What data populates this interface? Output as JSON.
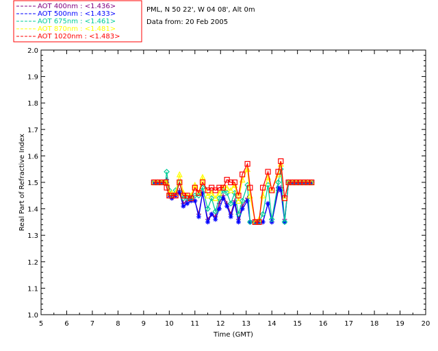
{
  "header": {
    "site_line": "PML, N 50 22', W 04 08', Alt 0m",
    "date_line": "Data from: 20 Feb 2005"
  },
  "chart_data": {
    "type": "line",
    "xlabel": "Time (GMT)",
    "ylabel": "Real Part of Refractive Index",
    "xlim": [
      5,
      20
    ],
    "ylim": [
      1.0,
      2.0
    ],
    "xticks": [
      "5",
      "6",
      "7",
      "8",
      "9",
      "10",
      "11",
      "12",
      "13",
      "14",
      "15",
      "16",
      "17",
      "18",
      "19",
      "20"
    ],
    "yticks": [
      "1.0",
      "1.1",
      "1.2",
      "1.3",
      "1.4",
      "1.5",
      "1.6",
      "1.7",
      "1.8",
      "1.9",
      "2.0"
    ],
    "grid": false,
    "legend_position": "top-left-outside",
    "series": [
      {
        "name": "AOT  400nm : <1.436>",
        "color": "#800080",
        "marker": "plus",
        "x": [
          9.4,
          9.55,
          9.7,
          9.85,
          9.9,
          10.0,
          10.1,
          10.25,
          10.4,
          10.55,
          10.7,
          10.85,
          11.0,
          11.15,
          11.3,
          11.5,
          11.65,
          11.8,
          11.95,
          12.1,
          12.25,
          12.4,
          12.55,
          12.7,
          12.85,
          13.05,
          13.15,
          13.35,
          13.5,
          13.65,
          13.85,
          14.0,
          14.25,
          14.35,
          14.5,
          14.65,
          14.8,
          14.95,
          15.1,
          15.25,
          15.4,
          15.55
        ],
        "y": [
          1.5,
          1.5,
          1.5,
          1.5,
          1.51,
          1.46,
          1.44,
          1.45,
          1.47,
          1.42,
          1.43,
          1.44,
          1.43,
          1.38,
          1.46,
          1.36,
          1.38,
          1.37,
          1.42,
          1.45,
          1.42,
          1.38,
          1.43,
          1.36,
          1.41,
          1.44,
          1.35,
          1.35,
          1.35,
          1.35,
          1.42,
          1.35,
          1.47,
          1.48,
          1.36,
          1.5,
          1.5,
          1.5,
          1.5,
          1.5,
          1.5,
          1.5
        ]
      },
      {
        "name": "AOT  500nm : <1.433>",
        "color": "#0000ff",
        "marker": "asterisk",
        "x": [
          9.4,
          9.55,
          9.7,
          9.85,
          9.9,
          10.0,
          10.1,
          10.25,
          10.4,
          10.55,
          10.7,
          10.85,
          11.0,
          11.15,
          11.3,
          11.5,
          11.65,
          11.8,
          11.95,
          12.1,
          12.25,
          12.4,
          12.55,
          12.7,
          12.85,
          13.05,
          13.15,
          13.35,
          13.5,
          13.65,
          13.85,
          14.0,
          14.25,
          14.35,
          14.5,
          14.65,
          14.8,
          14.95,
          15.1,
          15.25,
          15.4,
          15.55
        ],
        "y": [
          1.5,
          1.5,
          1.5,
          1.5,
          1.5,
          1.45,
          1.44,
          1.45,
          1.46,
          1.41,
          1.42,
          1.43,
          1.43,
          1.37,
          1.46,
          1.35,
          1.38,
          1.36,
          1.4,
          1.44,
          1.41,
          1.37,
          1.42,
          1.35,
          1.4,
          1.43,
          1.35,
          1.35,
          1.35,
          1.35,
          1.42,
          1.35,
          1.48,
          1.47,
          1.35,
          1.5,
          1.5,
          1.5,
          1.5,
          1.5,
          1.5,
          1.5
        ]
      },
      {
        "name": "AOT  675nm : <1.461>",
        "color": "#00cc99",
        "marker": "diamond",
        "x": [
          9.4,
          9.55,
          9.7,
          9.85,
          9.9,
          10.0,
          10.1,
          10.25,
          10.4,
          10.55,
          10.7,
          10.85,
          11.0,
          11.15,
          11.3,
          11.5,
          11.65,
          11.8,
          11.95,
          12.1,
          12.25,
          12.4,
          12.55,
          12.7,
          12.85,
          13.05,
          13.15,
          13.35,
          13.5,
          13.65,
          13.85,
          14.0,
          14.25,
          14.35,
          14.5,
          14.65,
          14.8,
          14.95,
          15.1,
          15.25,
          15.4,
          15.55
        ],
        "y": [
          1.5,
          1.5,
          1.5,
          1.5,
          1.54,
          1.47,
          1.45,
          1.47,
          1.5,
          1.44,
          1.44,
          1.44,
          1.45,
          1.45,
          1.48,
          1.4,
          1.44,
          1.39,
          1.44,
          1.47,
          1.46,
          1.42,
          1.46,
          1.38,
          1.43,
          1.49,
          1.35,
          1.35,
          1.35,
          1.38,
          1.49,
          1.36,
          1.5,
          1.55,
          1.35,
          1.5,
          1.5,
          1.5,
          1.5,
          1.5,
          1.5,
          1.5
        ]
      },
      {
        "name": "AOT  870nm : <1.481>",
        "color": "#ffff00",
        "marker": "triangle",
        "x": [
          9.4,
          9.55,
          9.7,
          9.85,
          9.9,
          10.0,
          10.1,
          10.25,
          10.4,
          10.55,
          10.7,
          10.85,
          11.0,
          11.15,
          11.3,
          11.5,
          11.65,
          11.8,
          11.95,
          12.1,
          12.25,
          12.4,
          12.55,
          12.7,
          12.85,
          13.05,
          13.15,
          13.35,
          13.5,
          13.65,
          13.85,
          14.0,
          14.25,
          14.35,
          14.5,
          14.65,
          14.8,
          14.95,
          15.1,
          15.25,
          15.4,
          15.55
        ],
        "y": [
          1.5,
          1.5,
          1.5,
          1.5,
          1.5,
          1.46,
          1.46,
          1.46,
          1.53,
          1.46,
          1.45,
          1.45,
          1.49,
          1.46,
          1.52,
          1.45,
          1.46,
          1.44,
          1.46,
          1.48,
          1.48,
          1.47,
          1.49,
          1.43,
          1.51,
          1.55,
          1.45,
          1.35,
          1.36,
          1.45,
          1.52,
          1.47,
          1.53,
          1.57,
          1.44,
          1.5,
          1.5,
          1.5,
          1.5,
          1.5,
          1.5,
          1.5
        ]
      },
      {
        "name": "AOT 1020nm : <1.483>",
        "color": "#ff0000",
        "marker": "square",
        "x": [
          9.4,
          9.55,
          9.7,
          9.85,
          9.9,
          10.0,
          10.1,
          10.25,
          10.4,
          10.55,
          10.7,
          10.85,
          11.0,
          11.15,
          11.3,
          11.5,
          11.65,
          11.8,
          11.95,
          12.1,
          12.25,
          12.4,
          12.55,
          12.7,
          12.85,
          13.05,
          13.15,
          13.35,
          13.5,
          13.65,
          13.85,
          14.0,
          14.25,
          14.35,
          14.5,
          14.65,
          14.8,
          14.95,
          15.1,
          15.25,
          15.4,
          15.55
        ],
        "y": [
          1.5,
          1.5,
          1.5,
          1.5,
          1.48,
          1.45,
          1.45,
          1.45,
          1.5,
          1.45,
          1.45,
          1.44,
          1.48,
          1.46,
          1.5,
          1.47,
          1.48,
          1.47,
          1.48,
          1.48,
          1.51,
          1.5,
          1.5,
          1.45,
          1.53,
          1.57,
          1.48,
          1.35,
          1.35,
          1.48,
          1.54,
          1.47,
          1.54,
          1.58,
          1.44,
          1.5,
          1.5,
          1.5,
          1.5,
          1.5,
          1.5,
          1.5
        ]
      }
    ]
  }
}
